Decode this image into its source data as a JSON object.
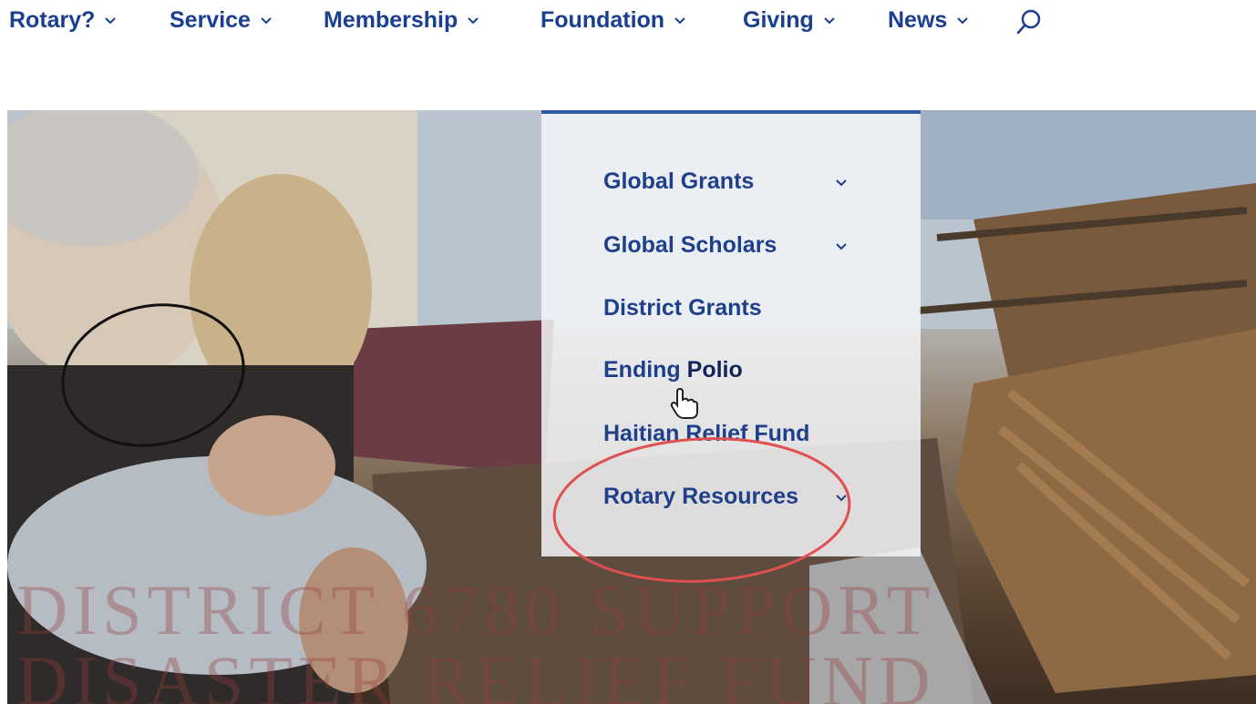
{
  "nav": {
    "items": [
      {
        "label": "Rotary?"
      },
      {
        "label": "Service"
      },
      {
        "label": "Membership"
      },
      {
        "label": "Foundation"
      },
      {
        "label": "Giving"
      },
      {
        "label": "News"
      }
    ],
    "search_icon": "search-icon",
    "chevron_icon": "chevron-down-icon"
  },
  "dropdown": {
    "items": [
      {
        "label": "Global Grants",
        "has_submenu": true
      },
      {
        "label": "Global Scholars",
        "has_submenu": true
      },
      {
        "label": "District Grants",
        "has_submenu": false
      },
      {
        "label_main": "Ending ",
        "label_hover": "Polio",
        "has_submenu": false
      },
      {
        "label": "Haitian Relief Fund",
        "has_submenu": false
      },
      {
        "label": "Rotary Resources",
        "has_submenu": true
      }
    ]
  },
  "hero": {
    "overlay_text_line1": "DISTRICT 6780 SUPPORT",
    "overlay_text_line2": "DISASTER RELIEF FUND"
  },
  "colors": {
    "nav_text": "#1a3f8f",
    "dropdown_text": "#1e3f8a",
    "dropdown_accent": "#2e5aa8",
    "annotation_red": "#e05050",
    "annotation_black": "#111111"
  }
}
